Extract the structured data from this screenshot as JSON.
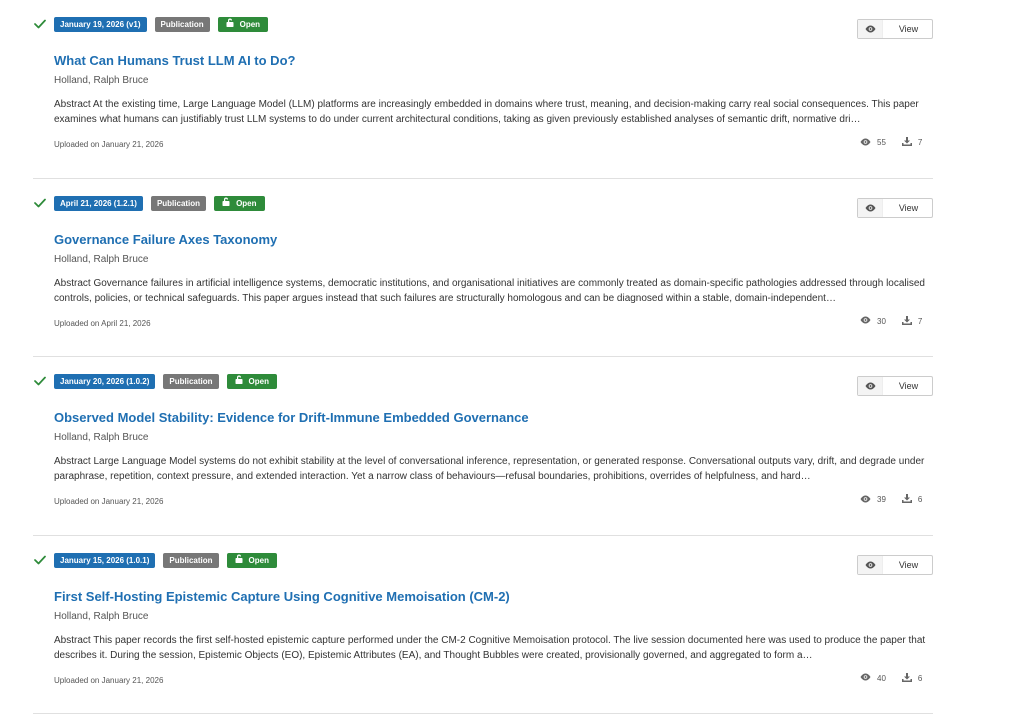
{
  "records": [
    {
      "version_date": "January 19, 2026 (v1)",
      "type": "Publication",
      "access": "Open",
      "view_label": "View",
      "title": "What Can Humans Trust LLM AI to Do?",
      "authors": "Holland, Ralph Bruce",
      "abstract": "Abstract At the existing time, Large Language Model (LLM) platforms are increasingly embedded in domains where trust, meaning, and decision-making carry real social consequences. This paper examines what humans can justifiably trust LLM systems to do under current architectural conditions, taking as given previously established analyses of semantic drift, normative dri…",
      "uploaded": "Uploaded on January 21, 2026",
      "views": "55",
      "downloads": "7"
    },
    {
      "version_date": "April 21, 2026 (1.2.1)",
      "type": "Publication",
      "access": "Open",
      "view_label": "View",
      "title": "Governance Failure Axes Taxonomy",
      "authors": "Holland, Ralph Bruce",
      "abstract": "Abstract Governance failures in artificial intelligence systems, democratic institutions, and organisational initiatives are commonly treated as domain-specific pathologies addressed through localised controls, policies, or technical safeguards. This paper argues instead that such failures are structurally homologous and can be diagnosed within a stable, domain-independent…",
      "uploaded": "Uploaded on April 21, 2026",
      "views": "30",
      "downloads": "7"
    },
    {
      "version_date": "January 20, 2026 (1.0.2)",
      "type": "Publication",
      "access": "Open",
      "view_label": "View",
      "title": "Observed Model Stability: Evidence for Drift-Immune Embedded Governance",
      "authors": "Holland, Ralph Bruce",
      "abstract": "Abstract Large Language Model systems do not exhibit stability at the level of conversational inference, representation, or generated response. Conversational outputs vary, drift, and degrade under paraphrase, repetition, context pressure, and extended interaction. Yet a narrow class of behaviours—refusal boundaries, prohibitions, overrides of helpfulness, and hard…",
      "uploaded": "Uploaded on January 21, 2026",
      "views": "39",
      "downloads": "6"
    },
    {
      "version_date": "January 15, 2026 (1.0.1)",
      "type": "Publication",
      "access": "Open",
      "view_label": "View",
      "title": "First Self-Hosting Epistemic Capture Using Cognitive Memoisation (CM-2)",
      "authors": "Holland, Ralph Bruce",
      "abstract": "Abstract This paper records the first self-hosted epistemic capture performed under the CM-2 Cognitive Memoisation protocol. The live session documented here was used to produce the paper that describes it. During the session, Epistemic Objects (EO), Epistemic Attributes (EA), and Thought Bubbles were created, provisionally governed, and aggregated to form a…",
      "uploaded": "Uploaded on January 21, 2026",
      "views": "40",
      "downloads": "6"
    }
  ],
  "icons": {
    "check": "checkmark-icon",
    "lock": "unlock-icon",
    "eye": "eye-icon",
    "download": "download-icon"
  },
  "colors": {
    "link": "#1f6fb2",
    "badge_date": "#1f6fb2",
    "badge_type": "#777777",
    "badge_open": "#2e8b3a",
    "check": "#2e8b3a"
  }
}
